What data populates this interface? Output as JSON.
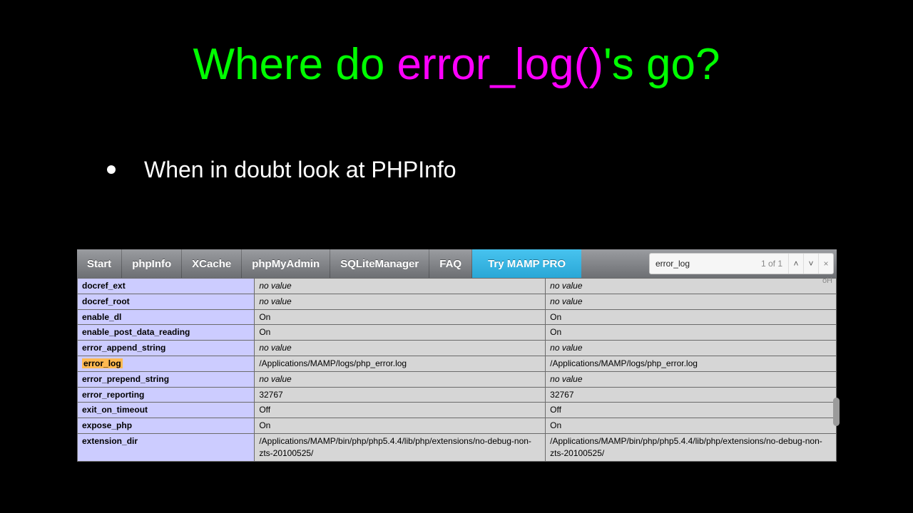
{
  "title": {
    "pre": "Where do ",
    "fn": "error_log()",
    "post": "'s go?"
  },
  "bullet": "When in doubt look at PHPInfo",
  "tabs": {
    "start": "Start",
    "phpinfo": "phpInfo",
    "xcache": "XCache",
    "pma": "phpMyAdmin",
    "sqlite": "SQLiteManager",
    "faq": "FAQ",
    "pro": "Try MAMP PRO"
  },
  "find": {
    "query": "error_log",
    "count": "1 of 1",
    "trail": "oH"
  },
  "rows": [
    {
      "k": "docref_ext",
      "l": "no value",
      "m": "no value",
      "it": true
    },
    {
      "k": "docref_root",
      "l": "no value",
      "m": "no value",
      "it": true
    },
    {
      "k": "enable_dl",
      "l": "On",
      "m": "On"
    },
    {
      "k": "enable_post_data_reading",
      "l": "On",
      "m": "On"
    },
    {
      "k": "error_append_string",
      "l": "no value",
      "m": "no value",
      "it": true
    },
    {
      "k": "error_log",
      "l": "/Applications/MAMP/logs/php_error.log",
      "m": "/Applications/MAMP/logs/php_error.log",
      "hl": true
    },
    {
      "k": "error_prepend_string",
      "l": "no value",
      "m": "no value",
      "it": true
    },
    {
      "k": "error_reporting",
      "l": "32767",
      "m": "32767"
    },
    {
      "k": "exit_on_timeout",
      "l": "Off",
      "m": "Off"
    },
    {
      "k": "expose_php",
      "l": "On",
      "m": "On"
    },
    {
      "k": "extension_dir",
      "l": "/Applications/MAMP/bin/php/php5.4.4/lib/php/extensions/no-debug-non-zts-20100525/",
      "m": "/Applications/MAMP/bin/php/php5.4.4/lib/php/extensions/no-debug-non-zts-20100525/"
    }
  ]
}
